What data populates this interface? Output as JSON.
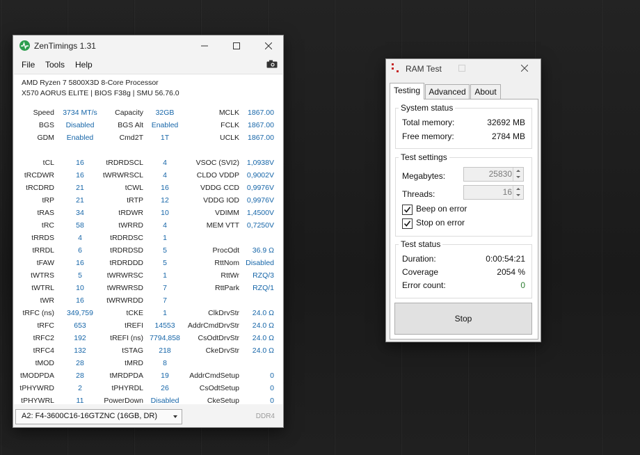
{
  "zen": {
    "title": "ZenTimings 1.31",
    "menu": [
      "File",
      "Tools",
      "Help"
    ],
    "cpu": "AMD Ryzen 7 5800X3D 8-Core Processor",
    "board": "X570 AORUS ELITE | BIOS F38g | SMU 56.76.0",
    "rows": [
      [
        "Speed",
        "3734 MT/s",
        "Capacity",
        "32GB",
        "MCLK",
        "1867.00"
      ],
      [
        "BGS",
        "Disabled",
        "BGS Alt",
        "Enabled",
        "FCLK",
        "1867.00"
      ],
      [
        "GDM",
        "Enabled",
        "Cmd2T",
        "1T",
        "UCLK",
        "1867.00"
      ],
      [
        "",
        "",
        "",
        "",
        "",
        ""
      ],
      [
        "tCL",
        "16",
        "tRDRDSCL",
        "4",
        "VSOC (SVI2)",
        "1,0938V"
      ],
      [
        "tRCDWR",
        "16",
        "tWRWRSCL",
        "4",
        "CLDO VDDP",
        "0,9002V"
      ],
      [
        "tRCDRD",
        "21",
        "tCWL",
        "16",
        "VDDG CCD",
        "0,9976V"
      ],
      [
        "tRP",
        "21",
        "tRTP",
        "12",
        "VDDG IOD",
        "0,9976V"
      ],
      [
        "tRAS",
        "34",
        "tRDWR",
        "10",
        "VDIMM",
        "1,4500V"
      ],
      [
        "tRC",
        "58",
        "tWRRD",
        "4",
        "MEM VTT",
        "0,7250V"
      ],
      [
        "tRRDS",
        "4",
        "tRDRDSC",
        "1",
        "",
        ""
      ],
      [
        "tRRDL",
        "6",
        "tRDRDSD",
        "5",
        "ProcOdt",
        "36.9 Ω"
      ],
      [
        "tFAW",
        "16",
        "tRDRDDD",
        "5",
        "RttNom",
        "Disabled"
      ],
      [
        "tWTRS",
        "5",
        "tWRWRSC",
        "1",
        "RttWr",
        "RZQ/3"
      ],
      [
        "tWTRL",
        "10",
        "tWRWRSD",
        "7",
        "RttPark",
        "RZQ/1"
      ],
      [
        "tWR",
        "16",
        "tWRWRDD",
        "7",
        "",
        ""
      ],
      [
        "tRFC (ns)",
        "349,759",
        "tCKE",
        "1",
        "ClkDrvStr",
        "24.0 Ω"
      ],
      [
        "tRFC",
        "653",
        "tREFI",
        "14553",
        "AddrCmdDrvStr",
        "24.0 Ω"
      ],
      [
        "tRFC2",
        "192",
        "tREFI (ns)",
        "7794,858",
        "CsOdtDrvStr",
        "24.0 Ω"
      ],
      [
        "tRFC4",
        "132",
        "tSTAG",
        "218",
        "CkeDrvStr",
        "24.0 Ω"
      ],
      [
        "tMOD",
        "28",
        "tMRD",
        "8",
        "",
        ""
      ],
      [
        "tMODPDA",
        "28",
        "tMRDPDA",
        "19",
        "AddrCmdSetup",
        "0"
      ],
      [
        "tPHYWRD",
        "2",
        "tPHYRDL",
        "26",
        "CsOdtSetup",
        "0"
      ],
      [
        "tPHYWRL",
        "11",
        "PowerDown",
        "Disabled",
        "CkeSetup",
        "0"
      ]
    ],
    "dimm": "A2: F4-3600C16-16GTZNC (16GB, DR)",
    "ddr": "DDR4",
    "accent": "#1565a8"
  },
  "ram": {
    "title": "RAM Test",
    "tabs": [
      "Testing",
      "Advanced",
      "About"
    ],
    "system_status": {
      "title": "System status",
      "total_label": "Total memory:",
      "total_value": "32692 MB",
      "free_label": "Free memory:",
      "free_value": "2784 MB"
    },
    "test_settings": {
      "title": "Test settings",
      "mb_label": "Megabytes:",
      "mb_value": "25830",
      "threads_label": "Threads:",
      "threads_value": "16",
      "beep_label": "Beep on error",
      "beep_checked": true,
      "stop_label": "Stop on error",
      "stop_checked": true
    },
    "test_status": {
      "title": "Test status",
      "duration_label": "Duration:",
      "duration_value": "0:00:54:21",
      "coverage_label": "Coverage",
      "coverage_value": "2054 %",
      "errors_label": "Error count:",
      "errors_value": "0",
      "errors_color": "#2e7d32"
    },
    "stop_label": "Stop"
  }
}
